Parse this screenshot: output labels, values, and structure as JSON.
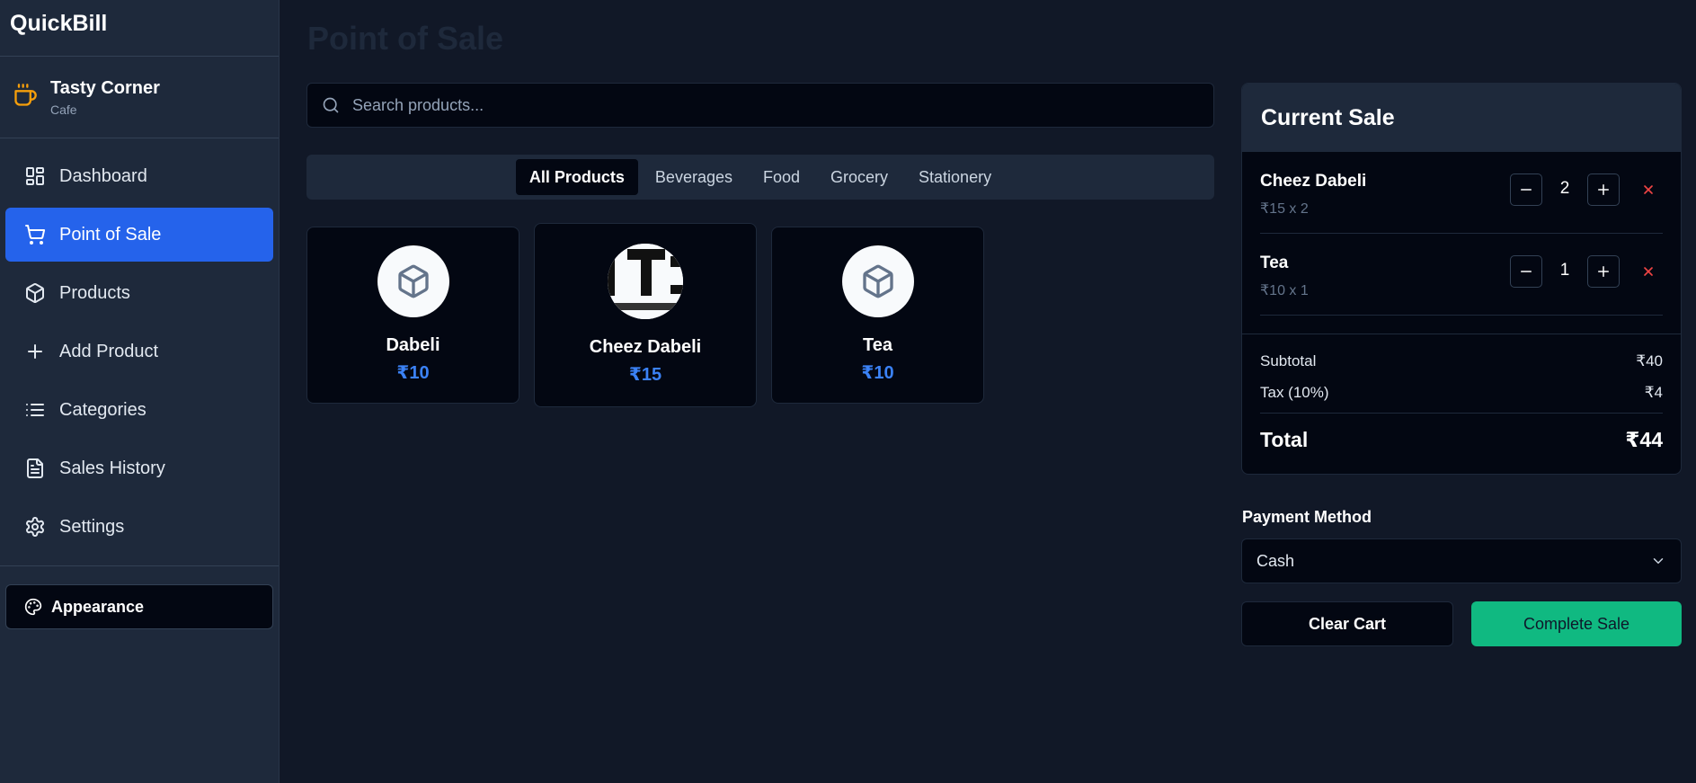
{
  "app": {
    "name": "QuickBill"
  },
  "store": {
    "name": "Tasty Corner",
    "type": "Cafe"
  },
  "sidebar": {
    "items": [
      {
        "label": "Dashboard",
        "icon": "dashboard-icon"
      },
      {
        "label": "Point of Sale",
        "icon": "cart-icon",
        "active": true
      },
      {
        "label": "Products",
        "icon": "box-icon"
      },
      {
        "label": "Add Product",
        "icon": "plus-icon"
      },
      {
        "label": "Categories",
        "icon": "list-icon"
      },
      {
        "label": "Sales History",
        "icon": "document-icon"
      },
      {
        "label": "Settings",
        "icon": "gear-icon"
      }
    ],
    "appearance_label": "Appearance"
  },
  "page": {
    "title": "Point of Sale"
  },
  "search": {
    "placeholder": "Search products...",
    "value": ""
  },
  "categories": {
    "tabs": [
      "All Products",
      "Beverages",
      "Food",
      "Grocery",
      "Stationery"
    ],
    "active": "All Products"
  },
  "products": [
    {
      "name": "Dabeli",
      "price": "₹10",
      "image": "box-icon"
    },
    {
      "name": "Cheez Dabeli",
      "price": "₹15",
      "image": "product-photo"
    },
    {
      "name": "Tea",
      "price": "₹10",
      "image": "box-icon"
    }
  ],
  "cart": {
    "title": "Current Sale",
    "items": [
      {
        "name": "Cheez Dabeli",
        "detail": "₹15 x 2",
        "qty": "2"
      },
      {
        "name": "Tea",
        "detail": "₹10 x 1",
        "qty": "1"
      }
    ],
    "subtotal_label": "Subtotal",
    "subtotal": "₹40",
    "tax_label": "Tax (10%)",
    "tax": "₹4",
    "total_label": "Total",
    "total": "₹44"
  },
  "payment": {
    "label": "Payment Method",
    "selected": "Cash"
  },
  "actions": {
    "clear_label": "Clear Cart",
    "complete_label": "Complete Sale"
  },
  "colors": {
    "background": "#111827",
    "sidebar": "#1e293b",
    "accent": "#2563eb",
    "price": "#3b82f6",
    "success": "#10b981",
    "danger": "#ef4444",
    "brand_icon": "#f59e0b"
  }
}
